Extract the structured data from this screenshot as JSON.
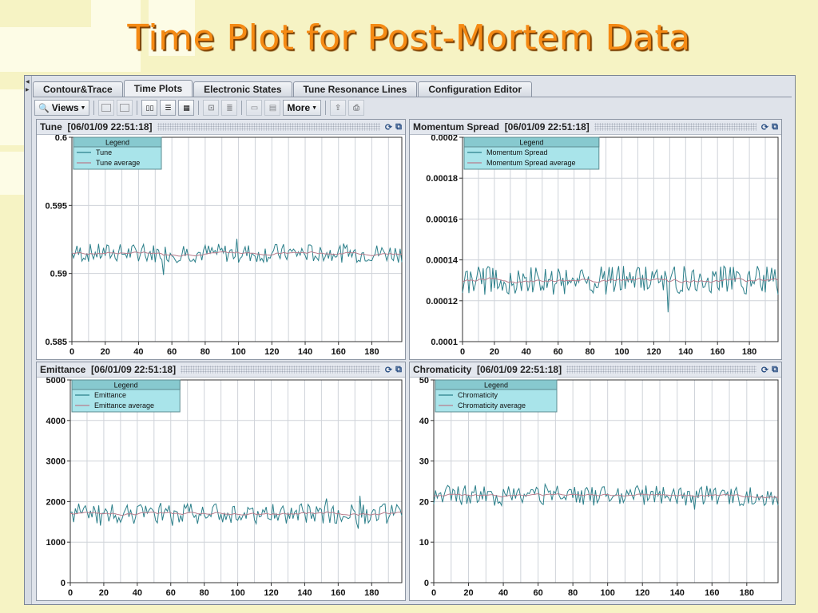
{
  "slide": {
    "title": "Time Plot for Post-Mortem Data"
  },
  "tabs": [
    {
      "label": "Contour&Trace",
      "active": false
    },
    {
      "label": "Time Plots",
      "active": true
    },
    {
      "label": "Electronic States",
      "active": false
    },
    {
      "label": "Tune Resonance Lines",
      "active": false
    },
    {
      "label": "Configuration Editor",
      "active": false
    }
  ],
  "toolbar": {
    "views_label": "Views",
    "more_label": "More",
    "icons": [
      "views-icon",
      "grid-2x1-icon",
      "grid-2x2-icon",
      "layout-columns-icon",
      "layout-rows-icon",
      "layout-quad-icon",
      "zoom-icon",
      "list-icon",
      "window-icon",
      "table-icon",
      "export-icon",
      "print-icon"
    ]
  },
  "colors": {
    "accent_title": "#f58a14",
    "raw_series": "#2b7f8a",
    "avg_series": "#b87c8c",
    "legend_bg": "#a9e4ea",
    "legend_head": "#87c9cf"
  },
  "panels": [
    {
      "title": "Tune",
      "timestamp": "[06/01/09 22:51:18]",
      "legend_title": "Legend",
      "icons": [
        "refresh-icon",
        "export-icon"
      ]
    },
    {
      "title": "Momentum Spread",
      "timestamp": "[06/01/09 22:51:18]",
      "legend_title": "Legend",
      "icons": [
        "refresh-icon",
        "export-icon"
      ]
    },
    {
      "title": "Emittance",
      "timestamp": "[06/01/09 22:51:18]",
      "legend_title": "Legend",
      "icons": [
        "refresh-icon",
        "export-icon"
      ]
    },
    {
      "title": "Chromaticity",
      "timestamp": "[06/01/09 22:51:18]",
      "legend_title": "Legend",
      "icons": [
        "refresh-icon",
        "export-icon"
      ]
    }
  ],
  "chart_data": [
    {
      "type": "line",
      "title": "Tune",
      "xlim": [
        0,
        198
      ],
      "ylim": [
        0.585,
        0.6
      ],
      "xticks": [
        0,
        20,
        40,
        60,
        80,
        100,
        120,
        140,
        160,
        180
      ],
      "yticks": [
        0.585,
        0.59,
        0.595,
        0.6
      ],
      "ytick_labels": [
        "0.585",
        "0.59",
        "0.595",
        "0.6"
      ],
      "grid": true,
      "legend_position": "top-left",
      "series": [
        {
          "name": "Tune",
          "kind": "raw",
          "center": 0.5915,
          "amplitude": 0.0007
        },
        {
          "name": "Tune average",
          "kind": "average",
          "center": 0.5915
        }
      ]
    },
    {
      "type": "line",
      "title": "Momentum Spread",
      "xlim": [
        0,
        198
      ],
      "ylim": [
        0.0001,
        0.0002
      ],
      "xticks": [
        0,
        20,
        40,
        60,
        80,
        100,
        120,
        140,
        160,
        180
      ],
      "yticks": [
        0.0001,
        0.00012,
        0.00014,
        0.00016,
        0.00018,
        0.0002
      ],
      "ytick_labels": [
        "0.0001",
        "0.00012",
        "0.00014",
        "0.00016",
        "0.00018",
        "0.0002"
      ],
      "grid": true,
      "legend_position": "top-left",
      "series": [
        {
          "name": "Momentum Spread",
          "kind": "raw",
          "center": 0.00013,
          "amplitude": 7e-06
        },
        {
          "name": "Momentum Spread average",
          "kind": "average",
          "center": 0.00013
        }
      ]
    },
    {
      "type": "line",
      "title": "Emittance",
      "xlim": [
        0,
        198
      ],
      "ylim": [
        0,
        5000
      ],
      "xticks": [
        0,
        20,
        40,
        60,
        80,
        100,
        120,
        140,
        160,
        180
      ],
      "yticks": [
        0,
        1000,
        2000,
        3000,
        4000,
        5000
      ],
      "ytick_labels": [
        "0",
        "1000",
        "2000",
        "3000",
        "4000",
        "5000"
      ],
      "grid": true,
      "legend_position": "top-left",
      "series": [
        {
          "name": "Emittance",
          "kind": "raw",
          "center": 1700,
          "amplitude": 250
        },
        {
          "name": "Emittance average",
          "kind": "average",
          "center": 1700
        }
      ]
    },
    {
      "type": "line",
      "title": "Chromaticity",
      "xlim": [
        0,
        198
      ],
      "ylim": [
        0,
        50
      ],
      "xticks": [
        0,
        20,
        40,
        60,
        80,
        100,
        120,
        140,
        160,
        180
      ],
      "yticks": [
        0,
        10,
        20,
        30,
        40,
        50
      ],
      "ytick_labels": [
        "0",
        "10",
        "20",
        "30",
        "40",
        "50"
      ],
      "grid": true,
      "legend_position": "top-left",
      "series": [
        {
          "name": "Chromaticity",
          "kind": "raw",
          "center": 21.5,
          "amplitude": 2.5
        },
        {
          "name": "Chromaticity average",
          "kind": "average",
          "center": 21.5
        }
      ]
    }
  ]
}
